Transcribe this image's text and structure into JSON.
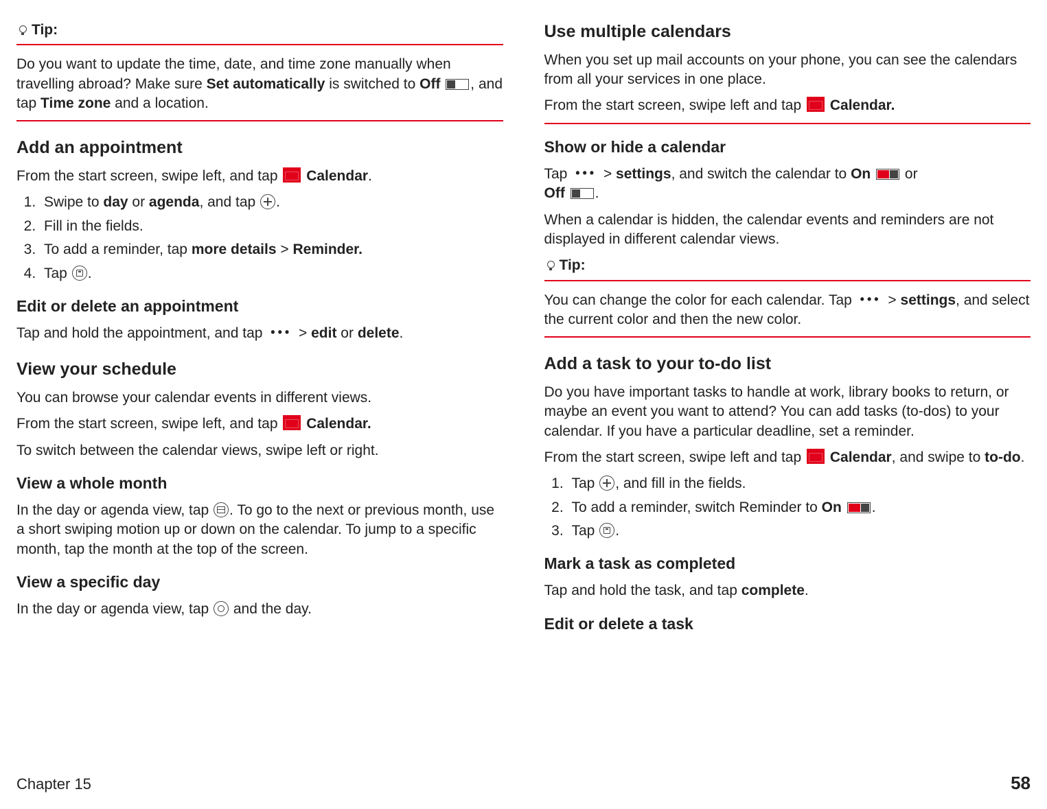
{
  "col1": {
    "tip_label": "Tip:",
    "tip_body_1": "Do you want to update the time, date, and time zone manually when travelling abroad? Make sure ",
    "tip_body_bold1": "Set automatically",
    "tip_body_2": " is switched to ",
    "tip_body_bold2": "Off",
    "tip_body_3": ", and tap ",
    "tip_body_bold3": "Time zone",
    "tip_body_4": " and a location.",
    "h_add_appt": "Add an appointment",
    "add_appt_intro_1": "From the start screen, swipe left, and tap ",
    "calendar_label": "Calendar",
    "ol1": {
      "li1_a": "Swipe to ",
      "li1_b1": "day",
      "li1_b2": " or ",
      "li1_b3": "agenda",
      "li1_c": ", and tap ",
      "li2": "Fill in the fields.",
      "li3_a": "To add a reminder, tap ",
      "li3_b1": "more details",
      "li3_b2": " > ",
      "li3_b3": "Reminder.",
      "li4_a": "Tap "
    },
    "h_edit_del": "Edit or delete an appointment",
    "edit_del_a": "Tap and hold the appointment, and tap ",
    "edit_del_b1": "edit",
    "edit_del_b2": " or ",
    "edit_del_b3": "delete",
    "h_view_sched": "View your schedule",
    "view_sched_p1": "You can browse your calendar events in different views.",
    "view_sched_p2a": "From the start screen, swipe left, and tap ",
    "view_sched_p2b": "Calendar.",
    "view_sched_p3": "To switch between the calendar views, swipe left or right.",
    "h_view_month": "View a whole month",
    "view_month_a": "In the day or agenda view, tap ",
    "view_month_b": ". To go to the next or previous month, use a short swiping motion up or down on the calendar. To jump to a specific month, tap the month at the top of the screen.",
    "h_view_day": "View a specific day",
    "view_day_a": "In the day or agenda view, tap ",
    "view_day_b": " and the day."
  },
  "col2": {
    "h_multi": "Use multiple calendars",
    "multi_p1": "When you set up mail accounts on your phone, you can see the calendars from all your services in one place.",
    "multi_p2a": "From the start screen, swipe left and tap ",
    "multi_p2b": "Calendar.",
    "h_showhide": "Show or hide a calendar",
    "showhide_a": "Tap ",
    "showhide_b": " > ",
    "showhide_c": "settings",
    "showhide_d": ", and switch the calendar to ",
    "showhide_on": "On",
    "showhide_or": " or ",
    "showhide_off": "Off",
    "showhide_p2": "When a calendar is hidden, the calendar events and reminders are not displayed in different calendar views.",
    "tip_label": "Tip:",
    "tip_body_a": "You can change the color for each calendar. Tap ",
    "tip_body_b": " > ",
    "tip_body_c": "settings",
    "tip_body_d": ", and select the current color and then the new color.",
    "h_todo": "Add a task to your to-do list",
    "todo_p1": "Do you have important tasks to handle at work, library books to return, or maybe an event you want to attend? You can add tasks (to-dos) to your calendar. If you have a particular deadline, set a reminder.",
    "todo_p2a": "From the start screen, swipe left and tap ",
    "todo_p2b": "Calendar",
    "todo_p2c": ", and swipe to ",
    "todo_p2d": "to-do",
    "ol2": {
      "li1_a": "Tap ",
      "li1_b": ", and fill in the fields.",
      "li2_a": "To add a reminder, switch Reminder to ",
      "li2_b": "On",
      "li3_a": "Tap "
    },
    "h_mark": "Mark a task as completed",
    "mark_a": "Tap and hold the task, and tap ",
    "mark_b": "complete",
    "h_edit_task": "Edit or delete a task"
  },
  "footer": {
    "chapter": "Chapter 15",
    "page": "58"
  }
}
